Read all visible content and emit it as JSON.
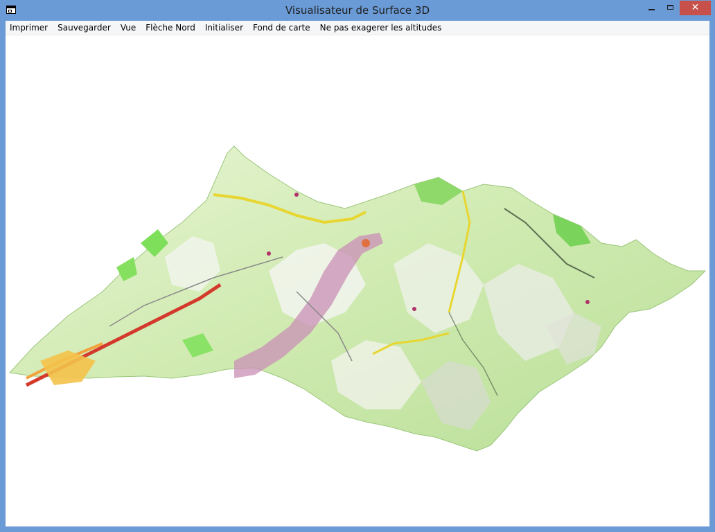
{
  "window": {
    "title": "Visualisateur de Surface 3D",
    "close_glyph": "✕",
    "icon": "app-window-icon"
  },
  "menubar": {
    "items": [
      {
        "label": "Imprimer"
      },
      {
        "label": "Sauvegarder"
      },
      {
        "label": "Vue"
      },
      {
        "label": "Flèche Nord"
      },
      {
        "label": "Initialiser"
      },
      {
        "label": "Fond de carte"
      },
      {
        "label": "Ne pas exagerer les altitudes"
      }
    ]
  },
  "colors": {
    "titlebar": "#6b9bd6",
    "close_button": "#c7504b",
    "menubar": "#f5f6f7",
    "canvas": "#ffffff"
  }
}
